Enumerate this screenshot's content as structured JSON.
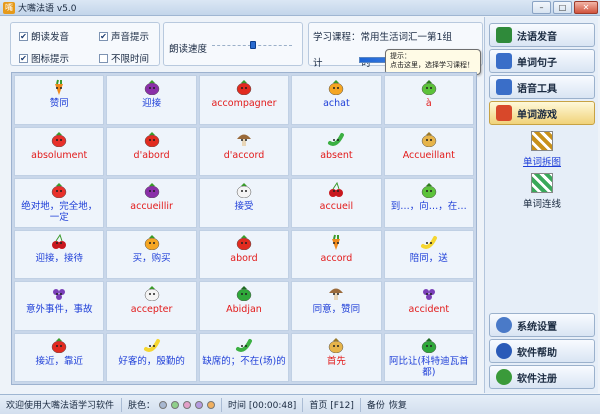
{
  "window": {
    "title": "大嘴法语 v5.0",
    "icon": "app-logo-icon",
    "buttons": [
      "minimize",
      "maximize",
      "close"
    ]
  },
  "options": {
    "items": [
      {
        "label": "朗读发音",
        "checked": true
      },
      {
        "label": "声音提示",
        "checked": true
      },
      {
        "label": "图标提示",
        "checked": true
      },
      {
        "label": "不限时间",
        "checked": false
      }
    ],
    "check_mark": "✔"
  },
  "speed": {
    "label": "朗读速度",
    "value_fraction": 0.52
  },
  "lesson": {
    "text": "学习课程：常用生活词汇一第1组",
    "timer_label": "计 时:",
    "timer_fraction": 1.0
  },
  "tooltip": {
    "title": "提示：",
    "body": "点击这里，选择学习课程！"
  },
  "grid": {
    "cells": [
      {
        "word": "赞同",
        "color": "blue",
        "icon": "carrot-icon"
      },
      {
        "word": "迎接",
        "color": "blue",
        "icon": "eggplant-icon"
      },
      {
        "word": "accompagner",
        "color": "red",
        "icon": "tomato-icon"
      },
      {
        "word": "achat",
        "color": "blue",
        "icon": "orange-icon"
      },
      {
        "word": "à",
        "color": "red",
        "icon": "lettuce-icon"
      },
      {
        "word": "absolument",
        "color": "red",
        "icon": "strawberry-icon"
      },
      {
        "word": "d'abord",
        "color": "red",
        "icon": "tomato-icon"
      },
      {
        "word": "d'accord",
        "color": "red",
        "icon": "mushroom-icon"
      },
      {
        "word": "absent",
        "color": "red",
        "icon": "cucumber-icon"
      },
      {
        "word": "Accueillant",
        "color": "red",
        "icon": "onion-icon"
      },
      {
        "word": "绝对地，完全地，一定",
        "color": "blue",
        "icon": "strawberry-icon"
      },
      {
        "word": "accueillir",
        "color": "red",
        "icon": "eggplant-icon"
      },
      {
        "word": "接受",
        "color": "blue",
        "icon": "radish-icon"
      },
      {
        "word": "accueil",
        "color": "red",
        "icon": "cherry-icon"
      },
      {
        "word": "到…，向…，在…",
        "color": "blue",
        "icon": "lettuce-icon"
      },
      {
        "word": "迎接，接待",
        "color": "blue",
        "icon": "cherry-icon"
      },
      {
        "word": "买，购买",
        "color": "blue",
        "icon": "orange-icon"
      },
      {
        "word": "abord",
        "color": "red",
        "icon": "tomato-icon"
      },
      {
        "word": "accord",
        "color": "red",
        "icon": "carrot-icon"
      },
      {
        "word": "陪同，送",
        "color": "blue",
        "icon": "banana-icon"
      },
      {
        "word": "意外事件，事故",
        "color": "blue",
        "icon": "grape-icon"
      },
      {
        "word": "accepter",
        "color": "red",
        "icon": "radish-icon"
      },
      {
        "word": "Abidjan",
        "color": "red",
        "icon": "pepper-icon"
      },
      {
        "word": "同意，赞同",
        "color": "blue",
        "icon": "mushroom-icon"
      },
      {
        "word": "accident",
        "color": "red",
        "icon": "grape-icon"
      },
      {
        "word": "接近，靠近",
        "color": "blue",
        "icon": "tomato-icon"
      },
      {
        "word": "好客的，殷勤的",
        "color": "blue",
        "icon": "banana-icon"
      },
      {
        "word": "缺席的；不在(场)的",
        "color": "blue",
        "icon": "cucumber-icon"
      },
      {
        "word": "首先",
        "color": "red",
        "icon": "onion-icon"
      },
      {
        "word": "阿比让(科特迪瓦首都)",
        "color": "blue",
        "icon": "pepper-icon"
      }
    ]
  },
  "sidebar": {
    "top_buttons": [
      {
        "label": "法语发音",
        "icon": "book-icon",
        "active": false
      },
      {
        "label": "单词句子",
        "icon": "cards-icon",
        "active": false
      },
      {
        "label": "语音工具",
        "icon": "speaker-icon",
        "active": false
      },
      {
        "label": "单词游戏",
        "icon": "puzzle-icon",
        "active": true
      }
    ],
    "sub_items": [
      {
        "label": "单词拆图",
        "icon": "grid-puzzle-icon",
        "selected": true
      },
      {
        "label": "单词连线",
        "icon": "link-lines-icon",
        "selected": false
      }
    ],
    "bottom_buttons": [
      {
        "label": "系统设置",
        "icon": "gear-icon"
      },
      {
        "label": "软件帮助",
        "icon": "help-icon"
      },
      {
        "label": "软件注册",
        "icon": "register-icon"
      }
    ]
  },
  "statusbar": {
    "welcome": "欢迎使用大嘴法语学习软件",
    "skin_label": "肤色：",
    "skin_colors": [
      "#a8b8d0",
      "#8fd08a",
      "#e3a0c8",
      "#b59be0",
      "#f0b060"
    ],
    "time": "时间 [00:00:48]",
    "home": "首页 [F12]",
    "backup": "备份",
    "restore": "恢复"
  },
  "colors": {
    "red_word": "#e21a1a",
    "blue_word": "#1f3fd8",
    "active_button": "#f0d27a"
  }
}
